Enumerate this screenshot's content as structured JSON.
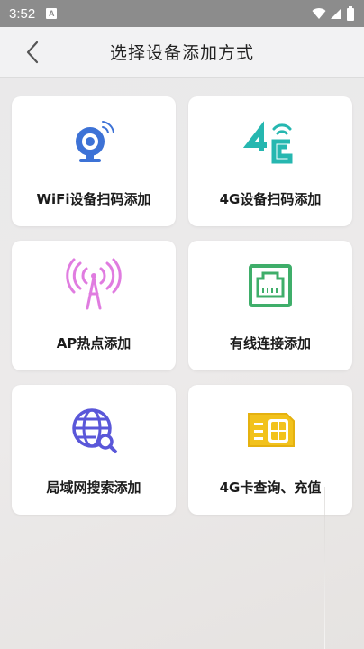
{
  "status_bar": {
    "time": "3:52",
    "badge": "A"
  },
  "header": {
    "title": "选择设备添加方式"
  },
  "cards": [
    {
      "label": "WiFi设备扫码添加",
      "icon": "wifi-camera-icon",
      "color": "#3d72d6"
    },
    {
      "label": "4G设备扫码添加",
      "icon": "4g-signal-icon",
      "color": "#26b7b0"
    },
    {
      "label": "AP热点添加",
      "icon": "antenna-icon",
      "color": "#e07ce0"
    },
    {
      "label": "有线连接添加",
      "icon": "ethernet-port-icon",
      "color": "#3fae6a"
    },
    {
      "label": "局域网搜索添加",
      "icon": "globe-search-icon",
      "color": "#5a57d9"
    },
    {
      "label": "4G卡查询、充值",
      "icon": "sim-card-icon",
      "color": "#f2c21c"
    }
  ],
  "colors": {
    "status_bar": "#8c8c8c",
    "header": "#f2f2f3",
    "background": "#eaeaea"
  }
}
